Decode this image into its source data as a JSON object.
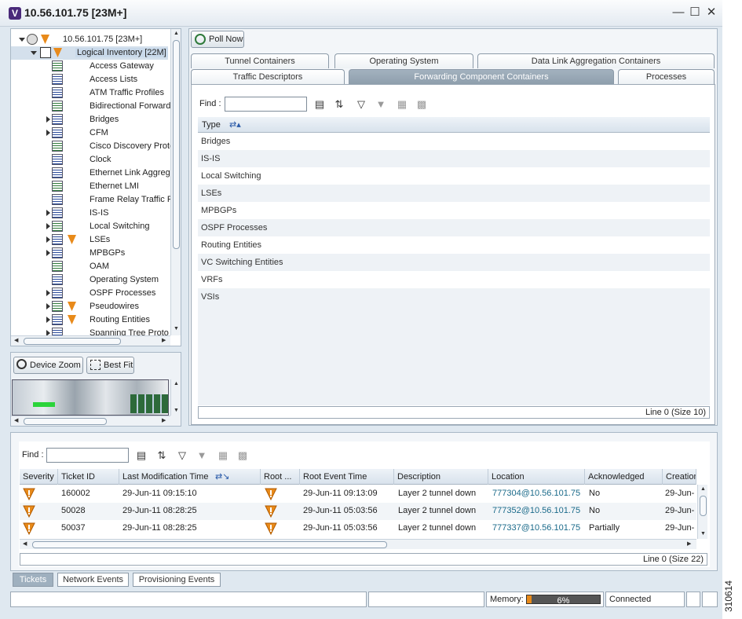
{
  "window": {
    "title": "10.56.101.75 [23M+]",
    "logo_letter": "V",
    "minimize": "—",
    "maximize": "☐",
    "close": "✕"
  },
  "tree": {
    "root_label": "10.56.101.75 [23M+]",
    "logical_label": "Logical Inventory [22M]",
    "items": [
      {
        "label": "Access Gateway",
        "expander": false,
        "badge": false
      },
      {
        "label": "Access Lists",
        "expander": false,
        "badge": false
      },
      {
        "label": "ATM Traffic Profiles",
        "expander": false,
        "badge": false
      },
      {
        "label": "Bidirectional Forward",
        "expander": false,
        "badge": false
      },
      {
        "label": "Bridges",
        "expander": true,
        "badge": false
      },
      {
        "label": "CFM",
        "expander": true,
        "badge": false
      },
      {
        "label": "Cisco Discovery Proto",
        "expander": false,
        "badge": false
      },
      {
        "label": "Clock",
        "expander": false,
        "badge": false
      },
      {
        "label": "Ethernet Link Aggreg",
        "expander": false,
        "badge": false
      },
      {
        "label": "Ethernet LMI",
        "expander": false,
        "badge": false
      },
      {
        "label": "Frame Relay Traffic P",
        "expander": false,
        "badge": false
      },
      {
        "label": "IS-IS",
        "expander": true,
        "badge": false
      },
      {
        "label": "Local Switching",
        "expander": true,
        "badge": false
      },
      {
        "label": "LSEs",
        "expander": true,
        "badge": true
      },
      {
        "label": "MPBGPs",
        "expander": true,
        "badge": false
      },
      {
        "label": "OAM",
        "expander": false,
        "badge": false
      },
      {
        "label": "Operating System",
        "expander": false,
        "badge": false
      },
      {
        "label": "OSPF Processes",
        "expander": true,
        "badge": false
      },
      {
        "label": "Pseudowires",
        "expander": true,
        "badge": true
      },
      {
        "label": "Routing Entities",
        "expander": true,
        "badge": true
      },
      {
        "label": "Spanning Tree Proto",
        "expander": true,
        "badge": false
      }
    ]
  },
  "zoom": {
    "device_zoom": "Device Zoom",
    "best_fit": "Best Fit"
  },
  "toolbar": {
    "poll_now": "Poll Now"
  },
  "tabs_row1": [
    "Tunnel Containers",
    "Operating System",
    "Data Link Aggregation Containers"
  ],
  "tabs_row2": [
    "Traffic Descriptors",
    "Forwarding Component Containers",
    "Processes"
  ],
  "content": {
    "find_label": "Find :",
    "column_type": "Type",
    "rows": [
      "Bridges",
      "IS-IS",
      "Local Switching",
      "LSEs",
      "MPBGPs",
      "OSPF Processes",
      "Routing Entities",
      "VC Switching Entities",
      "VRFs",
      "VSIs"
    ],
    "line_status": "Line 0 (Size 10)"
  },
  "tickets": {
    "find_label": "Find :",
    "columns": [
      "Severity",
      "Ticket ID",
      "Last Modification Time",
      "Root ...",
      "Root Event Time",
      "Description",
      "Location",
      "Acknowledged",
      "Creation"
    ],
    "rows": [
      {
        "id": "160002",
        "last_mod": "29-Jun-11 09:15:10",
        "root_time": "29-Jun-11 09:13:09",
        "desc": "Layer 2 tunnel down",
        "loc": "777304@10.56.101.75",
        "ack": "No",
        "creation": "29-Jun-1"
      },
      {
        "id": "50028",
        "last_mod": "29-Jun-11 08:28:25",
        "root_time": "29-Jun-11 05:03:56",
        "desc": "Layer 2 tunnel down",
        "loc": "777352@10.56.101.75",
        "ack": "No",
        "creation": "29-Jun-1"
      },
      {
        "id": "50037",
        "last_mod": "29-Jun-11 08:28:25",
        "root_time": "29-Jun-11 05:03:56",
        "desc": "Layer 2 tunnel down",
        "loc": "777337@10.56.101.75",
        "ack": "Partially",
        "creation": "29-Jun-1"
      }
    ],
    "line_status": "Line 0 (Size 22)",
    "bottom_tabs": [
      "Tickets",
      "Network Events",
      "Provisioning Events"
    ]
  },
  "statusbar": {
    "memory_label": "Memory:",
    "memory_value": "6%",
    "memory_fraction": 0.06,
    "connection": "Connected"
  },
  "figure_id": "310614",
  "colors": {
    "accent": "#9fb0bf",
    "warning": "#e88a1a",
    "link": "#1a6a8a"
  }
}
